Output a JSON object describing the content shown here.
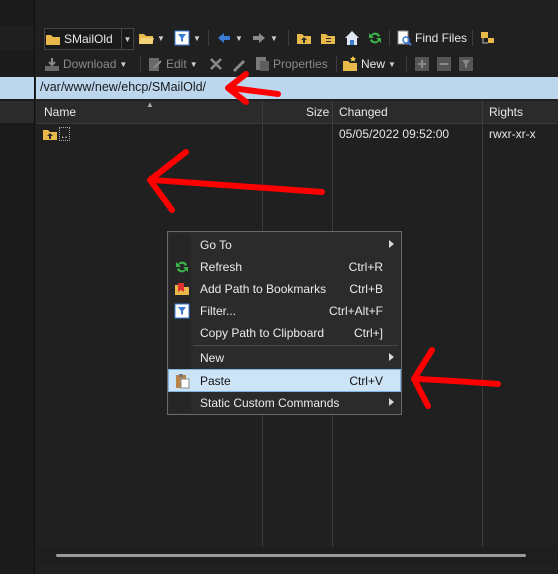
{
  "toolbar1": {
    "dir_selector": "SMailOld",
    "find_files_label": "Find Files"
  },
  "toolbar2": {
    "download_label": "Download",
    "edit_label": "Edit",
    "properties_label": "Properties",
    "new_label": "New"
  },
  "path_bar": {
    "path": "/var/www/new/ehcp/SMailOld/"
  },
  "columns": {
    "name": "Name",
    "size": "Size",
    "changed": "Changed",
    "rights": "Rights"
  },
  "rows": [
    {
      "name": "..",
      "size": "",
      "changed": "05/05/2022 09:52:00",
      "rights": "rwxr-xr-x"
    }
  ],
  "context_menu": {
    "items": [
      {
        "label": "Go To",
        "shortcut": "",
        "submenu": true,
        "icon": ""
      },
      {
        "label": "Refresh",
        "shortcut": "Ctrl+R",
        "submenu": false,
        "icon": "refresh-icon"
      },
      {
        "label": "Add Path to Bookmarks",
        "shortcut": "Ctrl+B",
        "submenu": false,
        "icon": "bookmark-icon"
      },
      {
        "label": "Filter...",
        "shortcut": "Ctrl+Alt+F",
        "submenu": false,
        "icon": "filter-icon"
      },
      {
        "label": "Copy Path to Clipboard",
        "shortcut": "Ctrl+]",
        "submenu": false,
        "icon": ""
      },
      {
        "label": "New",
        "shortcut": "",
        "submenu": true,
        "icon": ""
      },
      {
        "label": "Paste",
        "shortcut": "Ctrl+V",
        "submenu": false,
        "icon": "paste-icon",
        "highlighted": true
      },
      {
        "label": "Static Custom Commands",
        "shortcut": "",
        "submenu": true,
        "icon": ""
      }
    ]
  },
  "colors": {
    "path_bar_bg": "#bcd6ee",
    "highlight": "#cde4f7",
    "annotation": "#ff0000"
  }
}
